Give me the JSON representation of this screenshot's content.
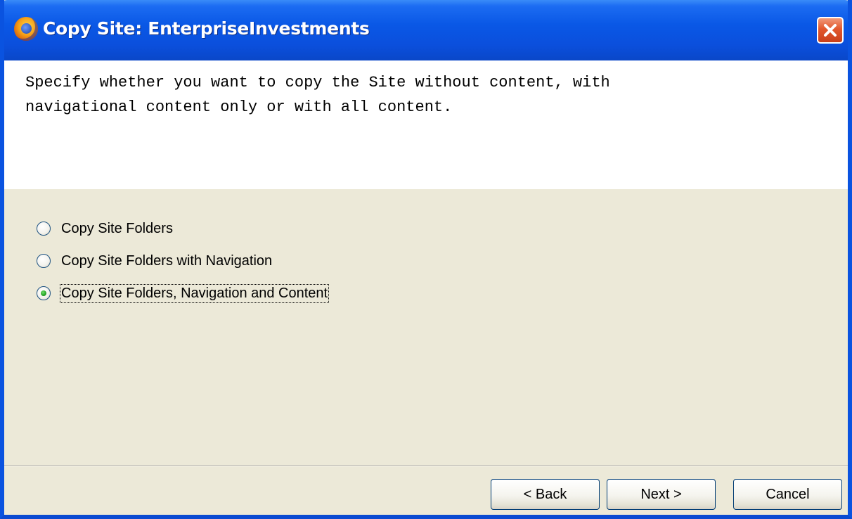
{
  "window": {
    "title": "Copy Site: EnterpriseInvestments"
  },
  "instructions": {
    "line1": "Specify whether you want to copy the Site without content, with",
    "line2": "navigational content only or with all content."
  },
  "options": [
    {
      "label": "Copy Site Folders",
      "checked": false
    },
    {
      "label": "Copy Site Folders with Navigation",
      "checked": false
    },
    {
      "label": "Copy Site Folders, Navigation and Content",
      "checked": true
    }
  ],
  "buttons": {
    "back": "< Back",
    "next": "Next >",
    "cancel": "Cancel"
  },
  "colors": {
    "titlebar": "#0a58e6",
    "dialog_background": "#ece9d8",
    "close_button": "#e2572c"
  },
  "icons": {
    "app": "browser-globe-icon",
    "close": "close-icon"
  }
}
